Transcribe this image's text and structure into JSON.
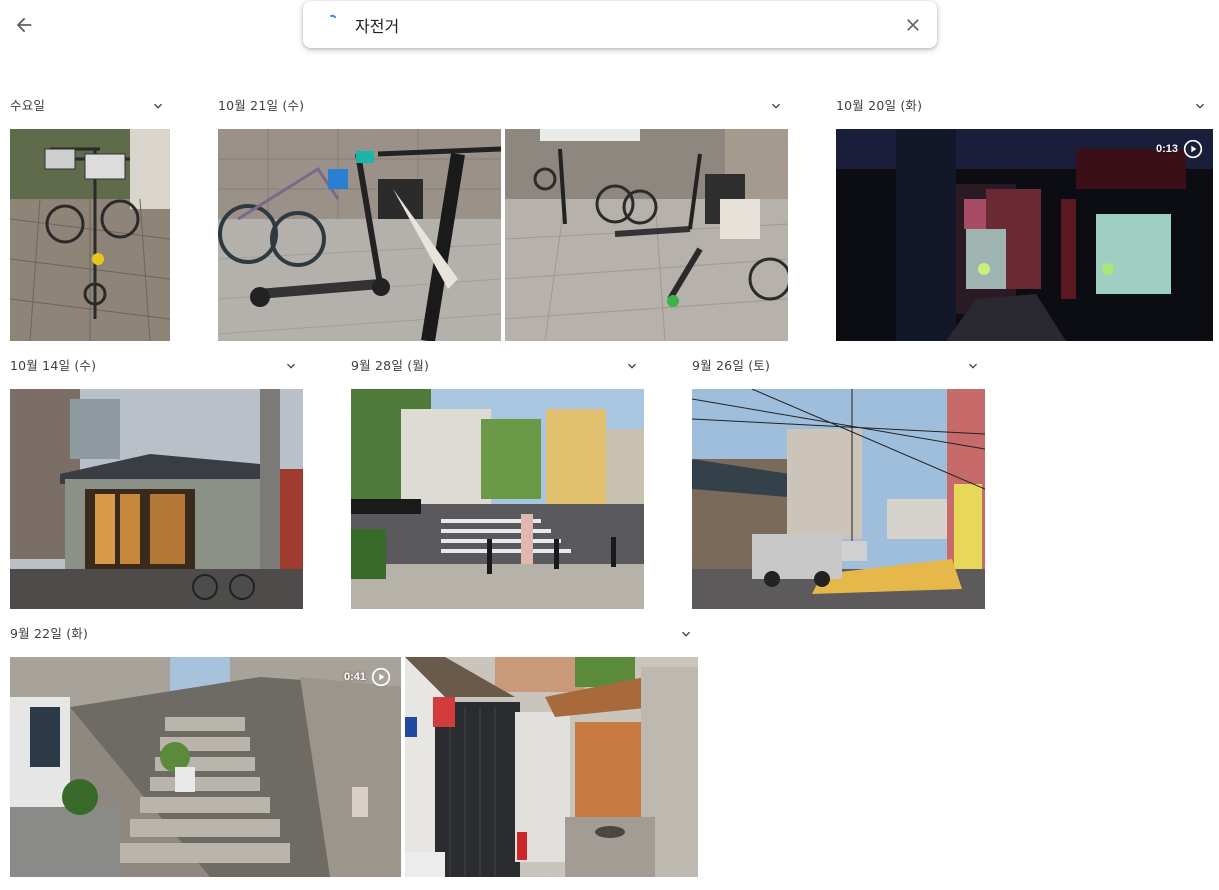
{
  "search": {
    "query": "자전거"
  },
  "groups": [
    {
      "label": "수요일"
    },
    {
      "label": "10월 21일 (수)"
    },
    {
      "label": "10월 20일 (화)",
      "video_duration": "0:13"
    },
    {
      "label": "10월 14일 (수)"
    },
    {
      "label": "9월 28일 (월)"
    },
    {
      "label": "9월 26일 (토)"
    },
    {
      "label": "9월 22일 (화)",
      "video_duration": "0:41"
    }
  ],
  "icons": {
    "back": "arrow-back-icon",
    "clear": "close-icon",
    "expand": "chevron-down-icon",
    "play": "play-circle-icon"
  },
  "colors": {
    "text": "#3c4043",
    "icon": "#5f6368",
    "spinner": "#4285f4"
  }
}
